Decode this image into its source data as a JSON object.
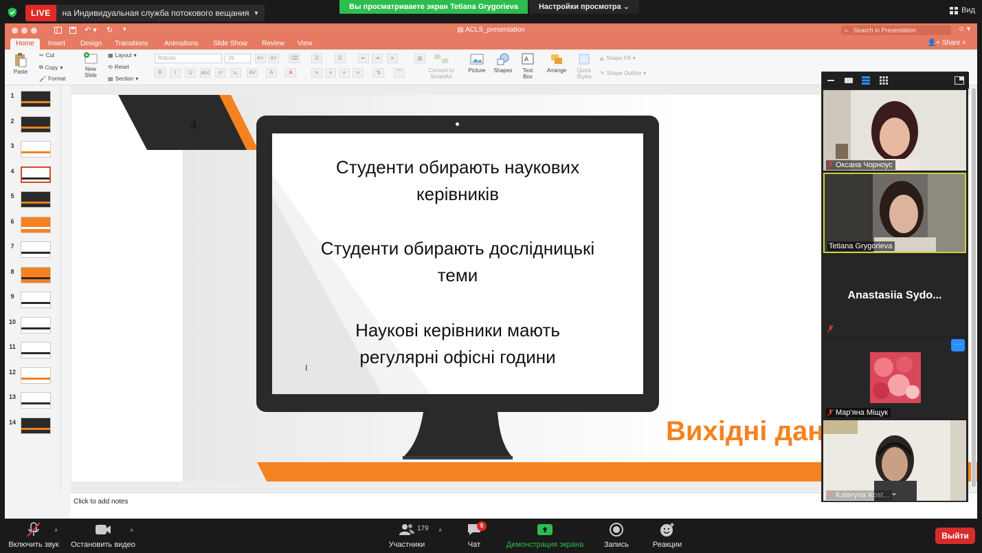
{
  "zoom": {
    "live_badge": "LIVE",
    "stream_title": "на Индивидуальная служба потокового вещания",
    "share_banner": "Вы просматриваете экран Tetiana Grygorieva",
    "view_settings": "Настройки просмотра",
    "view_label": "Вид",
    "bottom": {
      "mute": "Включить звук",
      "video": "Остановить видео",
      "participants": "Участники",
      "participants_count": "179",
      "chat": "Чат",
      "chat_badge": "5",
      "share": "Демонстрация экрана",
      "record": "Запись",
      "reactions": "Реакции",
      "exit": "Выйти"
    },
    "accent_green": "#2dbd4f",
    "accent_red": "#e02828"
  },
  "ppt": {
    "doc_title": "ACLS_presentation",
    "search_placeholder": "Search in Presentation",
    "share": "Share",
    "tabs": [
      "Home",
      "Insert",
      "Design",
      "Transitions",
      "Animations",
      "Slide Show",
      "Review",
      "View"
    ],
    "ribbon": {
      "paste": "Paste",
      "cut": "Cut",
      "copy": "Copy",
      "format": "Format",
      "new_slide": "New Slide",
      "layout": "Layout",
      "reset": "Reset",
      "section": "Section",
      "font_name": "Roboto",
      "font_size": "26",
      "convert": "Convert to SmartArt",
      "picture": "Picture",
      "shapes": "Shapes",
      "text_box": "Text Box",
      "arrange": "Arrange",
      "quick_styles": "Quick Styles",
      "shape_fill": "Shape Fill",
      "shape_outline": "Shape Outline"
    },
    "thumbnails": [
      "1",
      "2",
      "3",
      "4",
      "5",
      "6",
      "7",
      "8",
      "9",
      "10",
      "11",
      "12",
      "13",
      "14"
    ],
    "selected_slide": 4,
    "notes_placeholder": "Click to add notes",
    "slide": {
      "number": "4",
      "lines": [
        "Студенти обирають наукових",
        "керівників",
        "Студенти обирають дослідницькі",
        "теми",
        "Наукові керівники мають",
        "регулярні офісні години"
      ],
      "orange_title": "Вихідні дан"
    },
    "accent_orange": "#f58220",
    "title_bar_color": "#e67a62"
  },
  "participants": [
    {
      "name": "Оксана Чорноус",
      "muted": true
    },
    {
      "name": "Tetiana Grygorieva",
      "muted": false
    },
    {
      "name": "Anastasiia  Sydo...",
      "muted": true
    },
    {
      "name": "Мар'яна Міщук",
      "muted": true
    },
    {
      "name": "Kateryna Kost...",
      "muted": true
    }
  ]
}
